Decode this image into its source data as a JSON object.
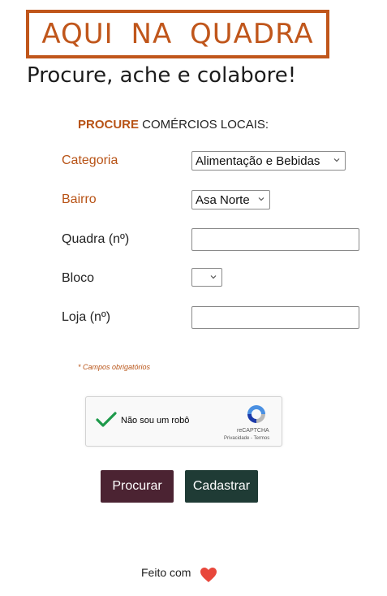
{
  "header": {
    "logo_text": "AQUI NA QUADRA",
    "tagline": "Procure, ache e colabore!"
  },
  "form": {
    "heading_strong": "PROCURE",
    "heading_rest": " COMÉRCIOS LOCAIS:",
    "fields": {
      "categoria": {
        "label": "Categoria",
        "value": "Alimentação e Bebidas",
        "required": true
      },
      "bairro": {
        "label": "Bairro",
        "value": "Asa Norte",
        "required": true
      },
      "quadra": {
        "label": "Quadra (nº)",
        "value": ""
      },
      "bloco": {
        "label": "Bloco",
        "value": ""
      },
      "loja": {
        "label": "Loja (nº)",
        "value": ""
      }
    },
    "required_note": "* Campos obrigatórios"
  },
  "captcha": {
    "label": "Não sou um robô",
    "brand": "reCAPTCHA",
    "links": "Privacidade - Termos",
    "checked": true
  },
  "buttons": {
    "search": "Procurar",
    "register": "Cadastrar"
  },
  "footer": {
    "text": "Feito com",
    "icon": "heart-icon"
  },
  "colors": {
    "accent": "#c0561b",
    "search_button": "#4b2332",
    "register_button": "#1f3b35",
    "heart": "#e8473b",
    "check": "#1e9a4b"
  }
}
